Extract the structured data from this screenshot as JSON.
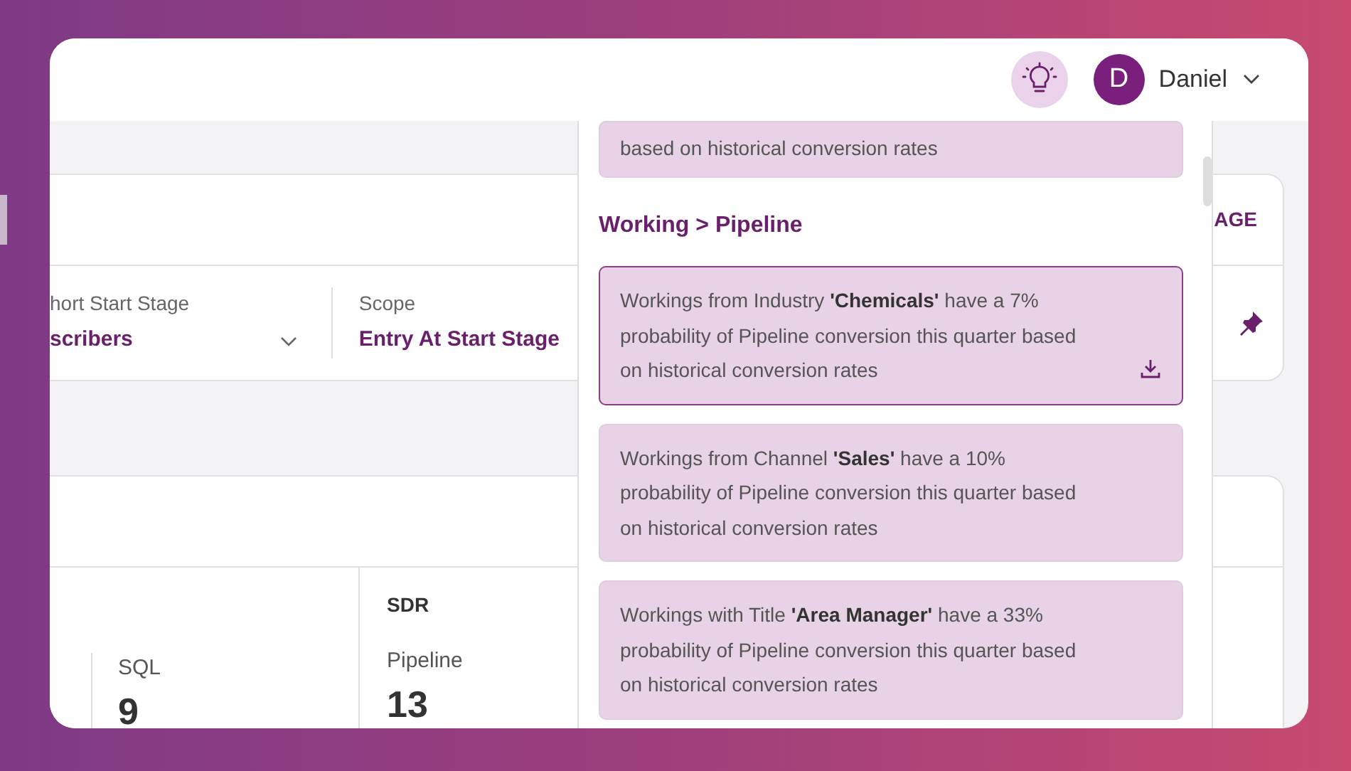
{
  "header": {
    "user": {
      "initial": "D",
      "name": "Daniel"
    }
  },
  "filter_card": {
    "action": "AGE",
    "filters": [
      {
        "kind": "dropdown",
        "label": "hort Start Stage",
        "value": "scribers"
      },
      {
        "kind": "static",
        "label": "Scope",
        "value": "Entry At Start Stage"
      }
    ]
  },
  "stats_card": {
    "group_label": "SDR",
    "metrics": [
      {
        "label": "SQL",
        "value": "9"
      },
      {
        "label": "Pipeline",
        "value": "13"
      }
    ]
  },
  "insights_panel": {
    "partial_card_text": "based on historical conversion rates",
    "section_title": "Working > Pipeline",
    "insights": [
      {
        "text": "Workings from Industry **'Chemicals'** have a 7% probability of Pipeline conversion this quarter based on historical conversion rates",
        "highlighted": true
      },
      {
        "text": "Workings from Channel **'Sales'** have a 10% probability of Pipeline conversion this quarter based on historical conversion rates",
        "highlighted": false
      },
      {
        "text": "Workings with Title **'Area Manager'** have a 33% probability of Pipeline conversion this quarter based on historical conversion rates",
        "highlighted": false
      }
    ]
  }
}
